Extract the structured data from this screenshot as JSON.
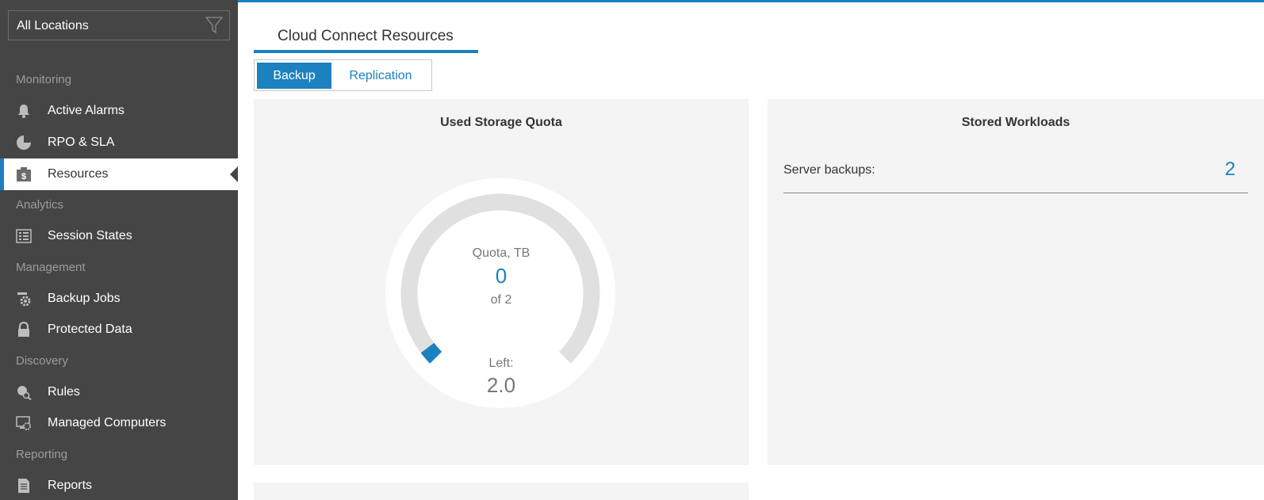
{
  "sidebar": {
    "location_filter": {
      "value": "All Locations",
      "icon": "filter-icon"
    },
    "sections": {
      "monitoring": "Monitoring",
      "analytics": "Analytics",
      "management": "Management",
      "discovery": "Discovery",
      "reporting": "Reporting"
    },
    "items": [
      {
        "label": "Active Alarms",
        "icon": "bell-icon"
      },
      {
        "label": "RPO & SLA",
        "icon": "pie-chart-icon"
      },
      {
        "label": "Resources",
        "icon": "resources-icon",
        "active": true
      },
      {
        "label": "Session States",
        "icon": "session-grid-icon"
      },
      {
        "label": "Backup Jobs",
        "icon": "gear-icon"
      },
      {
        "label": "Protected Data",
        "icon": "lock-icon"
      },
      {
        "label": "Rules",
        "icon": "rules-search-icon"
      },
      {
        "label": "Managed Computers",
        "icon": "managed-computer-icon"
      },
      {
        "label": "Reports",
        "icon": "report-icon"
      }
    ]
  },
  "main": {
    "page_tab": "Cloud Connect Resources",
    "segments": [
      "Backup",
      "Replication"
    ],
    "selected_segment": "Backup",
    "quota_panel": {
      "title": "Used Storage Quota",
      "gauge_label": "Quota, TB",
      "used": "0",
      "of_text": "of 2",
      "left_label": "Left:",
      "left_value": "2.0",
      "used_fraction": 0.03
    },
    "workloads_panel": {
      "title": "Stored Workloads",
      "rows": [
        {
          "label": "Server backups:",
          "value": "2"
        }
      ]
    }
  },
  "colors": {
    "accent": "#1b81bf",
    "sidebar_bg": "#454545",
    "panel_bg": "#f4f4f4",
    "gauge_track": "#e0e0e0"
  }
}
